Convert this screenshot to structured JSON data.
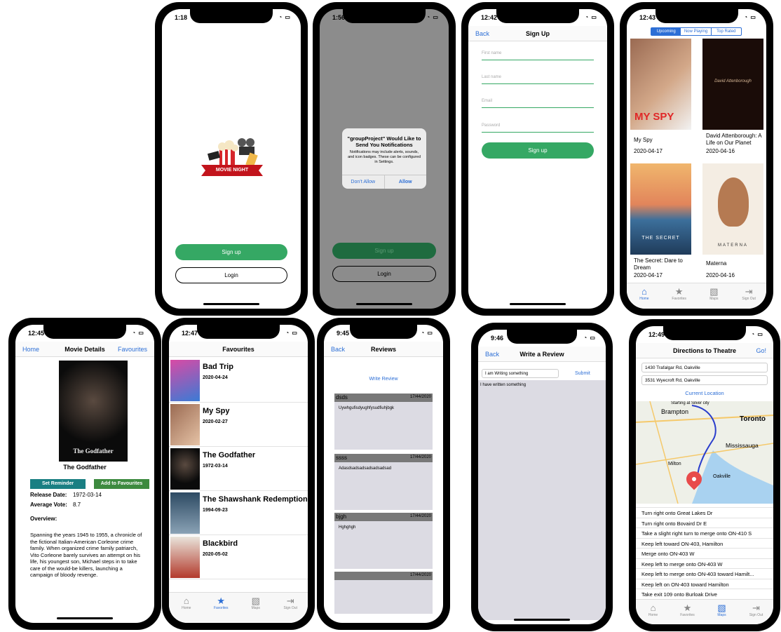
{
  "splash": {
    "time": "1:18",
    "brand": "MOVIE NIGHT",
    "signup": "Sign up",
    "login": "Login"
  },
  "alert": {
    "time": "1:56",
    "title": "\"groupProject\" Would Like to Send You Notifications",
    "message": "Notifications may include alerts, sounds, and icon badges. These can be configured in Settings.",
    "deny": "Don’t Allow",
    "allow": "Allow",
    "signup": "Sign up",
    "login": "Login"
  },
  "signupForm": {
    "time": "12:42",
    "back": "Back",
    "title": "Sign Up",
    "fields": [
      "First name",
      "Last name",
      "Email",
      "Password"
    ],
    "submit": "Sign up"
  },
  "movies": {
    "time": "12:43",
    "segments": [
      "Upcoming",
      "Now Playing",
      "Top Rated"
    ],
    "items": [
      {
        "title": "My Spy",
        "date": "2020-04-17",
        "poster_text": "MY SPY"
      },
      {
        "title": "David Attenborough: A Life on Our Planet",
        "date": "2020-04-16",
        "poster_text": "David Attenborough"
      },
      {
        "title": "The Secret: Dare to Dream",
        "date": "2020-04-17",
        "poster_text": "THE SECRET"
      },
      {
        "title": "Materna",
        "date": "2020-04-16",
        "poster_text": "MATERNA"
      }
    ]
  },
  "details": {
    "time": "12:45",
    "home": "Home",
    "title": "Movie Details",
    "favourites": "Favourites",
    "movie": "The Godfather",
    "poster_text": "The Godfather",
    "reminder": "Set Reminder",
    "addFav": "Add to Favourites",
    "releaseLabel": "Release Date:",
    "release": "1972-03-14",
    "voteLabel": "Average Vote:",
    "vote": "8.7",
    "overviewLabel": "Overview:",
    "overview": "Spanning the years 1945 to 1955, a chronicle of the fictional Italian-American Corleone crime family. When organized crime family patriarch, Vito Corleone barely survives an attempt on his life, his youngest son, Michael steps in to take care of the would-be killers, launching a campaign of bloody revenge."
  },
  "favs": {
    "time": "12:47",
    "title": "Favourites",
    "items": [
      {
        "title": "Bad Trip",
        "date": "2020-04-24",
        "poster_text": "BAD TRIP"
      },
      {
        "title": "My Spy",
        "date": "2020-02-27",
        "poster_text": "SPY"
      },
      {
        "title": "The Godfather",
        "date": "1972-03-14",
        "poster_text": "Godfather"
      },
      {
        "title": "The Shawshank Redemption",
        "date": "1994-09-23",
        "poster_text": ""
      },
      {
        "title": "Blackbird",
        "date": "2020-05-02",
        "poster_text": "BLACKBIRD"
      }
    ]
  },
  "reviews": {
    "time": "9:45",
    "back": "Back",
    "title": "Reviews",
    "write": "Write Review",
    "items": [
      {
        "name": "dsds",
        "date": "17/44/2020",
        "text": "Uywhgufisdyughfysudfiuhjbgk"
      },
      {
        "name": "ssss",
        "date": "17/44/2020",
        "text": "Adasdsadsadsadsadsadsad"
      },
      {
        "name": "bjgh",
        "date": "17/44/2020",
        "text": "Hghghgh"
      },
      {
        "name": "",
        "date": "17/44/2020",
        "text": ""
      }
    ]
  },
  "writeReview": {
    "time": "9:46",
    "back": "Back",
    "title": "Write a Review",
    "input": "I am Writing something",
    "submit": "Submit",
    "body": "I have written something"
  },
  "directions": {
    "time": "12:49",
    "title": "Directions to Theatre",
    "go": "Go!",
    "from": "1430 Trafalgar Rd, Oakville",
    "to": "3531 Wyecroft Rd, Oakville",
    "current": "Current Location",
    "map_labels": [
      "Starting at Silver city",
      "Brampton",
      "Toronto",
      "Mississauga",
      "Milton",
      "Oakville"
    ],
    "steps": [
      "Turn right onto Great Lakes Dr",
      "Turn right onto Bovaird Dr E",
      "Take a slight right turn to merge onto ON-410 S",
      "Keep left toward ON-403, Hamilton",
      "Merge onto ON-403 W",
      "Keep left to merge onto ON-403 W",
      "Keep left to merge onto ON-403 toward Hamilt...",
      "Keep left on ON-403 toward Hamilton",
      "Take exit 109 onto Burloak Drive"
    ]
  },
  "tabs": [
    "Home",
    "Favorites",
    "Maps",
    "Sign Out"
  ]
}
